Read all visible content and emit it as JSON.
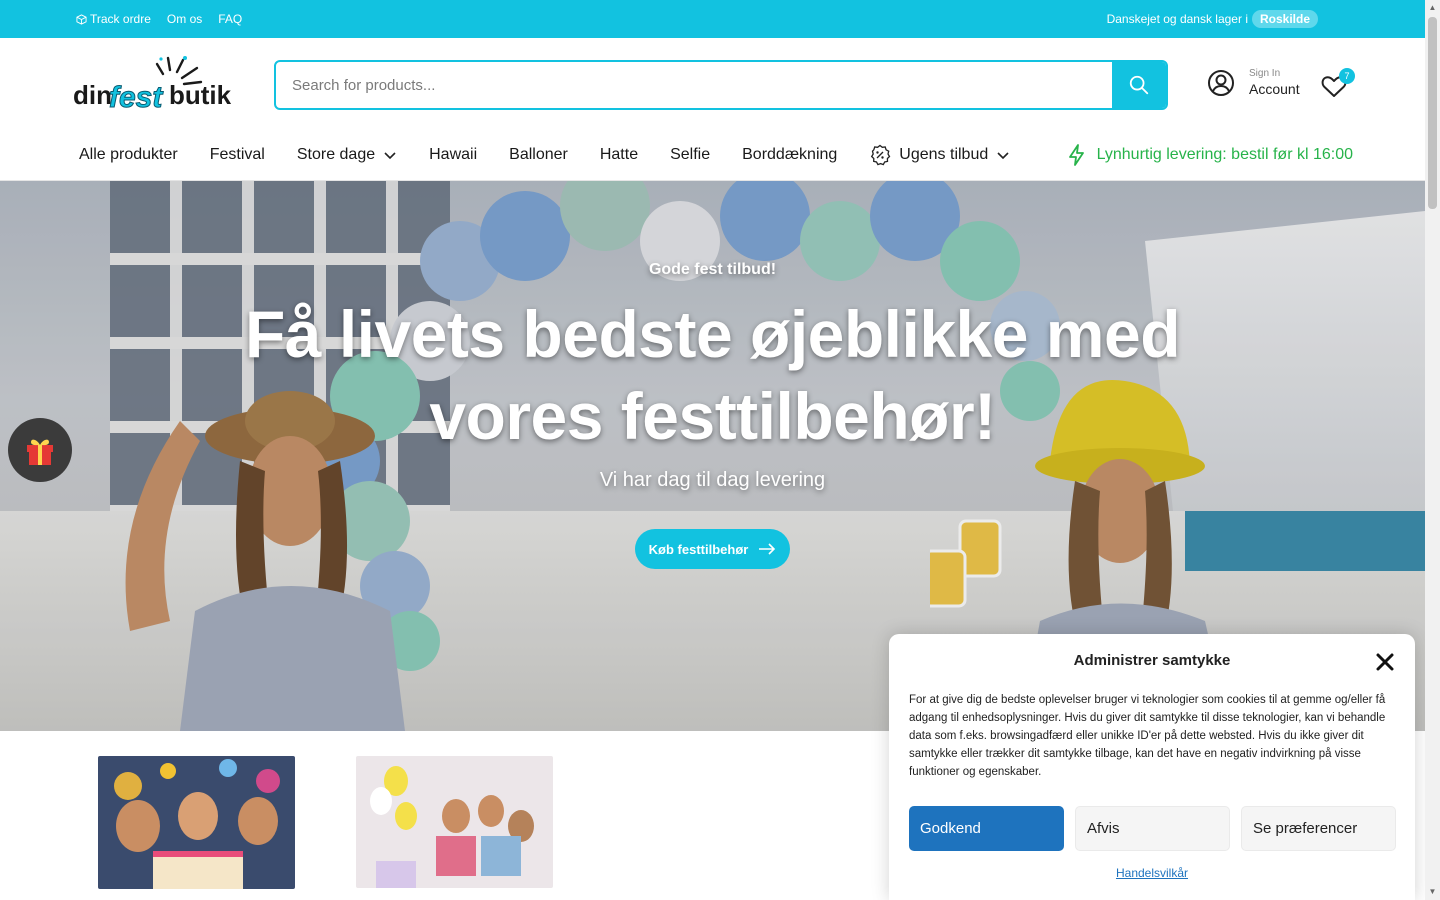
{
  "topbar": {
    "track_label": "Track ordre",
    "about_label": "Om os",
    "faq_label": "FAQ",
    "notice_text": "Danskejet og dansk lager i",
    "location_label": "Roskilde"
  },
  "header": {
    "logo_text": "dinfestbutik",
    "search_placeholder": "Search for products...",
    "account_small": "Sign In",
    "account_big": "Account",
    "wishlist_count": "7"
  },
  "nav": {
    "items": [
      {
        "label": "Alle produkter"
      },
      {
        "label": "Festival"
      },
      {
        "label": "Store dage"
      },
      {
        "label": "Hawaii"
      },
      {
        "label": "Balloner"
      },
      {
        "label": "Hatte"
      },
      {
        "label": "Selfie"
      },
      {
        "label": "Borddækning"
      },
      {
        "label": "Ugens tilbud"
      }
    ],
    "fast_delivery": "Lynhurtig levering: bestil før kl 16:00"
  },
  "hero": {
    "kicker": "Gode fest tilbud!",
    "title_line1": "Få livets bedste øjeblikke med",
    "title_line2": "vores festtilbehør!",
    "subtitle": "Vi har dag til dag levering",
    "cta_label": "Køb festtilbehør"
  },
  "consent": {
    "title": "Administrer samtykke",
    "body": "For at give dig de bedste oplevelser bruger vi teknologier som cookies til at gemme og/eller få adgang til enhedsoplysninger. Hvis du giver dit samtykke til disse teknologier, kan vi behandle data som f.eks. browsingadfærd eller unikke ID'er på dette websted. Hvis du ikke giver dit samtykke eller trækker dit samtykke tilbage, kan det have en negativ indvirkning på visse funktioner og egenskaber.",
    "accept_label": "Godkend",
    "deny_label": "Afvis",
    "prefs_label": "Se præferencer",
    "terms_link": "Handelsvilkår"
  },
  "colors": {
    "accent": "#12c2e0",
    "fast_green": "#27b34a",
    "consent_blue": "#1e73be"
  }
}
